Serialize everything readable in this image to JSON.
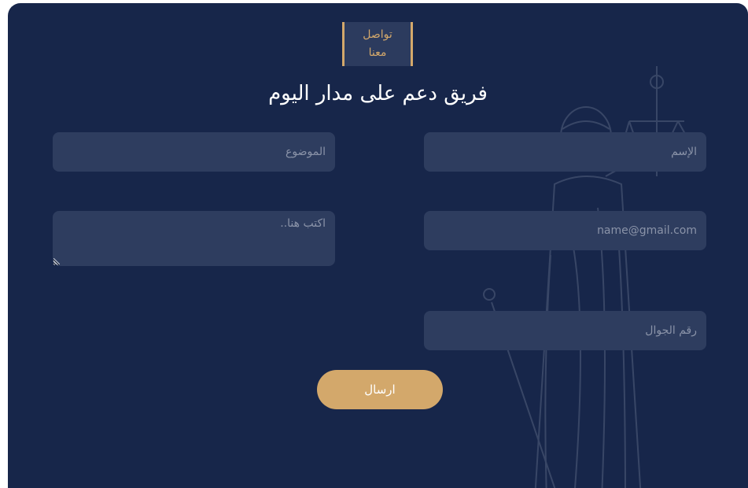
{
  "header": {
    "badge_line1": "تواصل",
    "badge_line2": "معنا",
    "title": "فريق دعم على مدار اليوم"
  },
  "form": {
    "name_placeholder": "الإسم",
    "email_placeholder": "name@gmail.com",
    "phone_placeholder": "رقم الجوال",
    "subject_placeholder": "الموضوع",
    "message_placeholder": "اكتب هنا..",
    "submit_label": "ارسال"
  },
  "colors": {
    "background": "#17264a",
    "field": "#2e3d5f",
    "accent": "#d3a86b",
    "text": "#ffffff"
  },
  "decoration": {
    "background_image": "lady-justice-statue-icon"
  }
}
